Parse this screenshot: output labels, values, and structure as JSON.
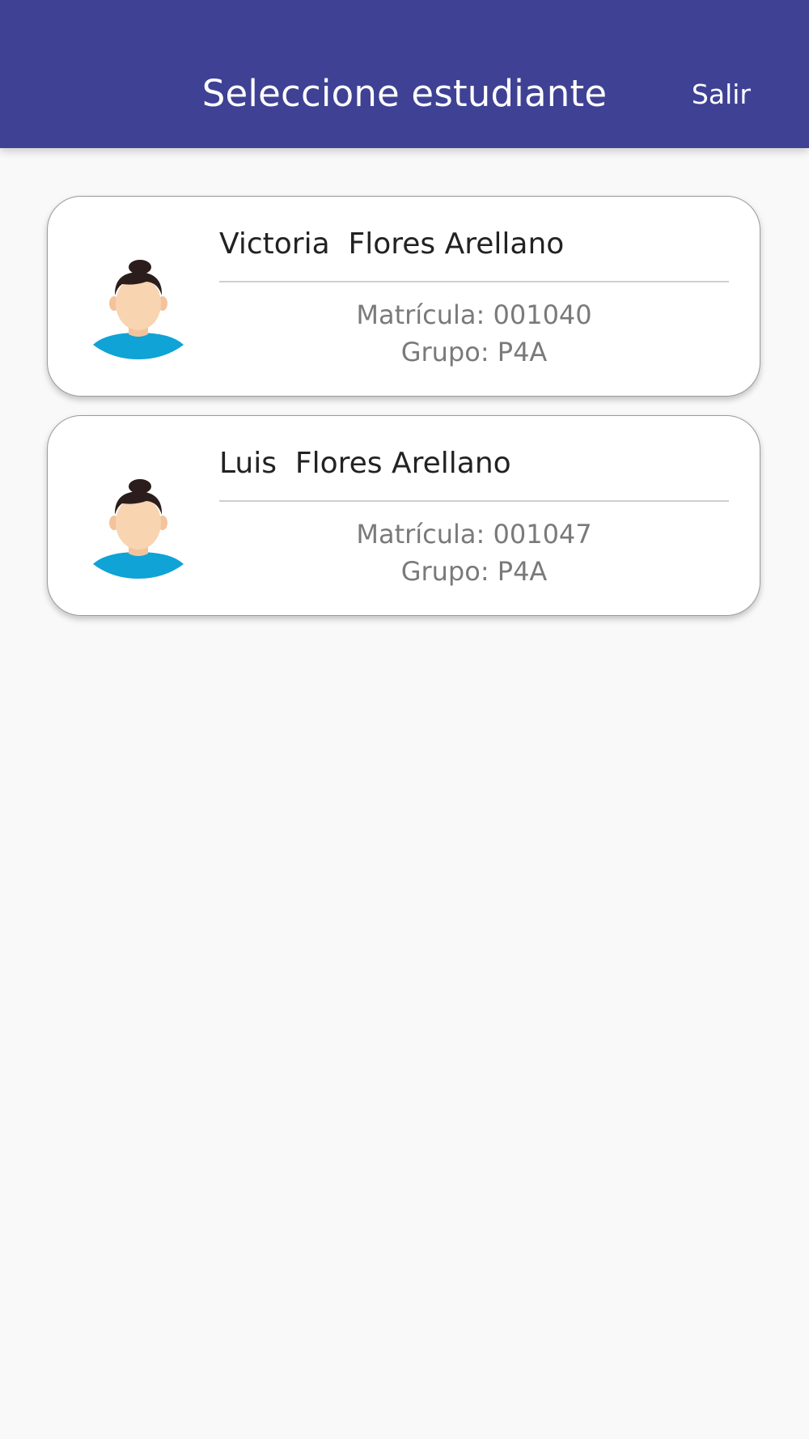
{
  "header": {
    "title": "Seleccione estudiante",
    "logout_label": "Salir"
  },
  "students": [
    {
      "name": "Victoria  Flores Arellano",
      "matricula": "Matrícula: 001040",
      "grupo": "Grupo: P4A",
      "avatar_icon": "student-avatar-icon"
    },
    {
      "name": "Luis  Flores Arellano",
      "matricula": "Matrícula: 001047",
      "grupo": "Grupo: P4A",
      "avatar_icon": "student-avatar-icon"
    }
  ],
  "colors": {
    "app_bar": "#3f4194",
    "background": "#f9f9f9",
    "avatar_shirt": "#0fa3d6",
    "avatar_skin": "#f8d4b0",
    "avatar_hair": "#2b1d1c"
  }
}
